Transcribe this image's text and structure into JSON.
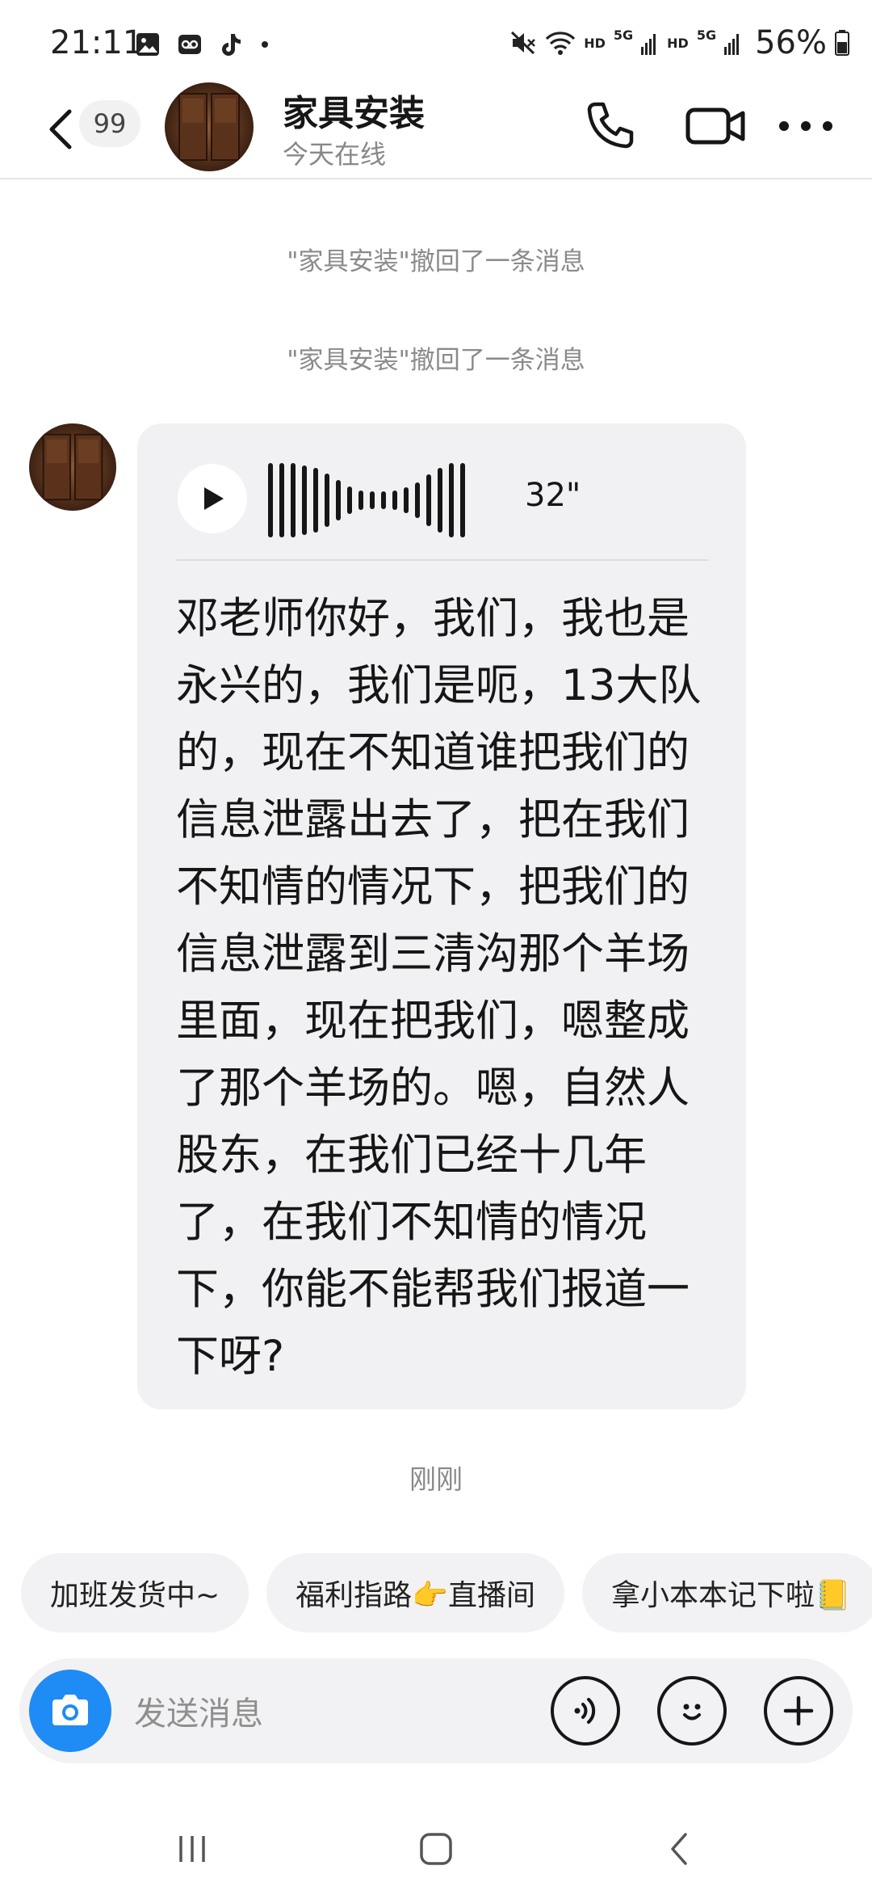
{
  "status_bar": {
    "time": "21:11",
    "left_icons": [
      "gallery-icon",
      "voicemail-icon",
      "tiktok-icon",
      "dot-icon"
    ],
    "right_icons": [
      "mute-icon",
      "wifi-icon",
      "signal-5g-icon",
      "signal-5g-icon",
      "battery-icon"
    ],
    "hd_label_1": "HD",
    "hd_label_2": "HD",
    "net_label_1": "5G",
    "net_label_2": "5G",
    "battery": "56%"
  },
  "header": {
    "unread_count": "99",
    "contact_name": "家具安装",
    "contact_status": "今天在线",
    "icons": [
      "back-icon",
      "phone-icon",
      "video-call-icon",
      "more-icon"
    ]
  },
  "chat": {
    "system_messages": [
      "\"家具安装\"撤回了一条消息",
      "\"家具安装\"撤回了一条消息"
    ],
    "voice_message": {
      "duration": "32\"",
      "transcript": "邓老师你好，我们，我也是永兴的，我们是呃，13大队的，现在不知道谁把我们的信息泄露出去了，把在我们不知情的情况下，把我们的信息泄露到三清沟那个羊场里面，现在把我们，嗯整成了那个羊场的。嗯，自然人股东，在我们已经十几年了，在我们不知情的情况下，你能不能帮我们报道一下呀?"
    },
    "message_time": "刚刚"
  },
  "quick_replies": [
    "加班发货中~",
    "福利指路👉直播间",
    "拿小本本记下啦📒"
  ],
  "input_bar": {
    "placeholder": "发送消息",
    "icons": [
      "camera-icon",
      "voice-input-icon",
      "emoji-icon",
      "plus-icon"
    ]
  },
  "colors": {
    "accent": "#1f8bf5",
    "bubble_bg": "#f1f1f3",
    "secondary_text": "#8a8a8a"
  }
}
